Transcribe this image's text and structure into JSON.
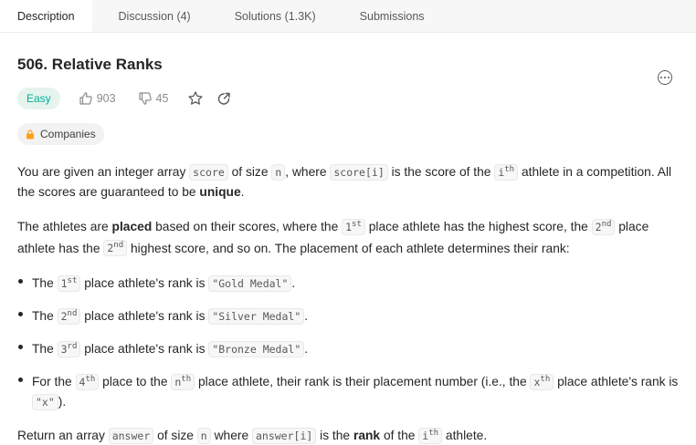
{
  "tabs": [
    {
      "label": "Description"
    },
    {
      "label": "Discussion (4)"
    },
    {
      "label": "Solutions (1.3K)"
    },
    {
      "label": "Submissions"
    }
  ],
  "problem": {
    "title": "506. Relative Ranks",
    "difficulty": "Easy",
    "likes": "903",
    "dislikes": "45",
    "companies_label": "Companies"
  },
  "description": {
    "p1": {
      "t1": "You are given an integer array ",
      "c1": "score",
      "t2": " of size ",
      "c2": "n",
      "t3": ", where ",
      "c3": "score[i]",
      "t4": " is the score of the ",
      "c4_base": "i",
      "c4_sup": "th",
      "t5": " athlete in a competition. All the scores are guaranteed to be ",
      "b1": "unique",
      "t6": "."
    },
    "p2": {
      "t1": "The athletes are ",
      "b1": "placed",
      "t2": " based on their scores, where the ",
      "c1_base": "1",
      "c1_sup": "st",
      "t3": " place athlete has the highest score, the ",
      "c2_base": "2",
      "c2_sup": "nd",
      "t4": " place athlete has the ",
      "c3_base": "2",
      "c3_sup": "nd",
      "t5": " highest score, and so on. The placement of each athlete determines their rank:"
    },
    "bullets": [
      {
        "t1": "The ",
        "c_base": "1",
        "c_sup": "st",
        "t2": " place athlete's rank is ",
        "val": "\"Gold Medal\"",
        "t3": "."
      },
      {
        "t1": "The ",
        "c_base": "2",
        "c_sup": "nd",
        "t2": " place athlete's rank is ",
        "val": "\"Silver Medal\"",
        "t3": "."
      },
      {
        "t1": "The ",
        "c_base": "3",
        "c_sup": "rd",
        "t2": " place athlete's rank is ",
        "val": "\"Bronze Medal\"",
        "t3": "."
      }
    ],
    "bullet4": {
      "t1": "For the ",
      "c1_base": "4",
      "c1_sup": "th",
      "t2": " place to the ",
      "c2_base": "n",
      "c2_sup": "th",
      "t3": " place athlete, their rank is their placement number (i.e., the ",
      "c3_base": "x",
      "c3_sup": "th",
      "t4": " place athlete's rank is ",
      "val": "\"x\"",
      "t5": ")."
    },
    "p3": {
      "t1": "Return an array ",
      "c1": "answer",
      "t2": " of size ",
      "c2": "n",
      "t3": " where ",
      "c3": "answer[i]",
      "t4": " is the ",
      "b1": "rank",
      "t5": " of the ",
      "c4_base": "i",
      "c4_sup": "th",
      "t6": " athlete."
    }
  },
  "icons": {
    "like": "thumbs-up-icon",
    "dislike": "thumbs-down-icon",
    "star": "star-icon",
    "share": "share-icon",
    "lock": "lock-icon",
    "more": "more-icon"
  },
  "colors": {
    "easy_text": "#00af9b",
    "easy_bg": "#e6f4ee",
    "lock": "#ffa116"
  }
}
